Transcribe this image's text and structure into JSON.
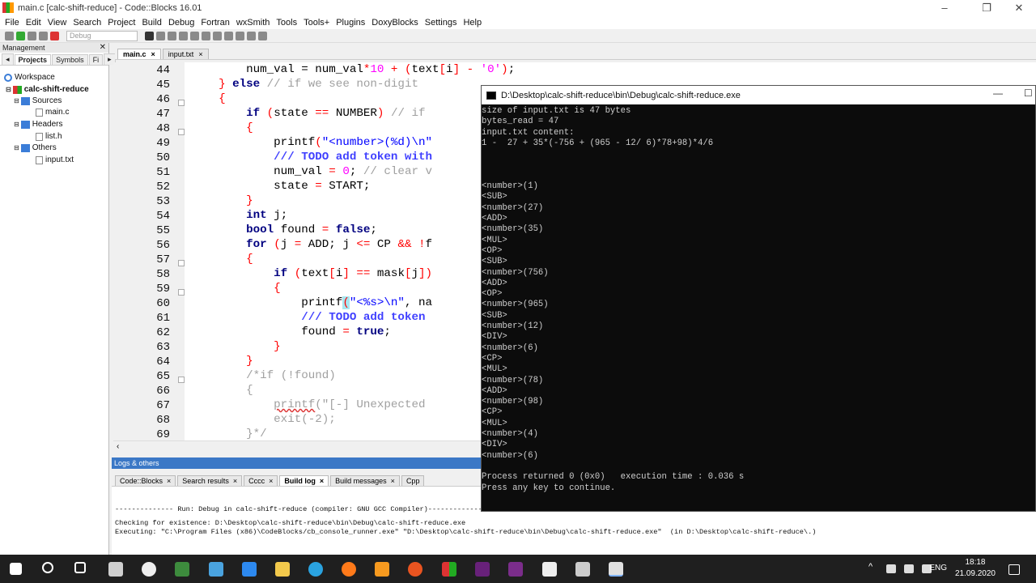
{
  "window": {
    "title": "main.c [calc-shift-reduce] - Code::Blocks 16.01",
    "controls": [
      "–",
      "❐",
      "✕"
    ]
  },
  "menu": [
    "File",
    "Edit",
    "View",
    "Search",
    "Project",
    "Build",
    "Debug",
    "Fortran",
    "wxSmith",
    "Tools",
    "Tools+",
    "Plugins",
    "DoxyBlocks",
    "Settings",
    "Help"
  ],
  "toolbar": {
    "build_target": "Debug"
  },
  "management": {
    "title": "Management",
    "close": "✕",
    "tabs": [
      "Projects",
      "Symbols",
      "Fi"
    ],
    "tree": {
      "workspace": "Workspace",
      "project": "calc-shift-reduce",
      "sources": "Sources",
      "source_file": "main.c",
      "headers": "Headers",
      "header_file": "list.h",
      "others": "Others",
      "other_file": "input.txt"
    }
  },
  "editor": {
    "tabs": [
      {
        "label": "main.c",
        "close": "×"
      },
      {
        "label": "input.txt",
        "close": "×"
      }
    ],
    "line_numbers": [
      "44",
      "45",
      "46",
      "47",
      "48",
      "49",
      "50",
      "51",
      "52",
      "53",
      "54",
      "55",
      "56",
      "57",
      "58",
      "59",
      "60",
      "61",
      "62",
      "63",
      "64",
      "65",
      "66",
      "67",
      "68",
      "69"
    ]
  },
  "logs": {
    "title": "Logs & others",
    "tabs": [
      "Code::Blocks",
      "Search results",
      "Cccc",
      "Build log",
      "Build messages",
      "Cpp"
    ],
    "lines": [
      "-------------- Run: Debug in calc-shift-reduce (compiler: GNU GCC Compiler)---------------",
      "Checking for existence: D:\\Desktop\\calc-shift-reduce\\bin\\Debug\\calc-shift-reduce.exe",
      "Executing: \"C:\\Program Files (x86)\\CodeBlocks/cb_console_runner.exe\" \"D:\\Desktop\\calc-shift-reduce\\bin\\Debug\\calc-shift-reduce.exe\"  (in D:\\Desktop\\calc-shift-reduce\\.)"
    ]
  },
  "console": {
    "title": "D:\\Desktop\\calc-shift-reduce\\bin\\Debug\\calc-shift-reduce.exe",
    "controls": [
      "—",
      "☐"
    ],
    "lines": [
      "size of input.txt is 47 bytes",
      "bytes_read = 47",
      "input.txt content:",
      "1 -  27 + 35*(-756 + (965 - 12/ 6)*78+98)*4/6",
      "",
      "",
      "",
      "<number>(1)",
      "<SUB>",
      "<number>(27)",
      "<ADD>",
      "<number>(35)",
      "<MUL>",
      "<OP>",
      "<SUB>",
      "<number>(756)",
      "<ADD>",
      "<OP>",
      "<number>(965)",
      "<SUB>",
      "<number>(12)",
      "<DIV>",
      "<number>(6)",
      "<CP>",
      "<MUL>",
      "<number>(78)",
      "<ADD>",
      "<number>(98)",
      "<CP>",
      "<MUL>",
      "<number>(4)",
      "<DIV>",
      "<number>(6)",
      "",
      "Process returned 0 (0x0)   execution time : 0.036 s",
      "Press any key to continue."
    ]
  },
  "taskbar": {
    "language": "ENG",
    "time": "18:18",
    "date": "21.09.2020"
  }
}
